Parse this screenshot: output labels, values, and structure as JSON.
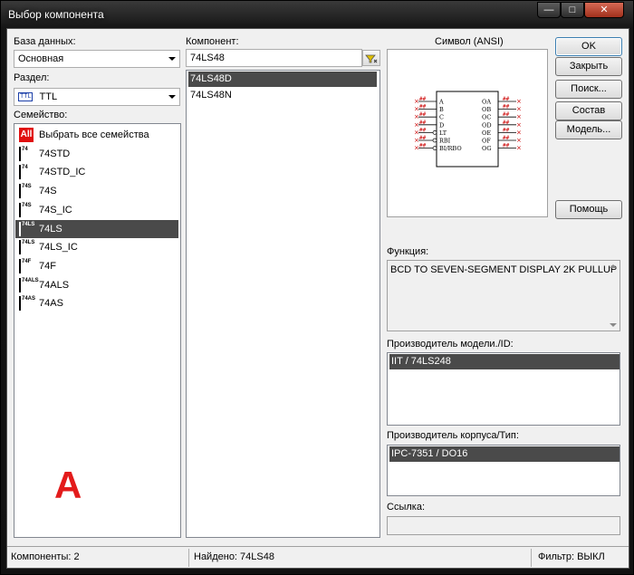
{
  "window": {
    "title": "Выбор компонента"
  },
  "database": {
    "label": "База данных:",
    "value": "Основная"
  },
  "section": {
    "label": "Раздел:",
    "value": "TTL",
    "icon_text": "TTL"
  },
  "family": {
    "label": "Семейство:",
    "items": [
      {
        "label": "Выбрать все семейства",
        "icon": "All"
      },
      {
        "label": "74STD",
        "icon": "74"
      },
      {
        "label": "74STD_IC",
        "icon": "74"
      },
      {
        "label": "74S",
        "icon": "74S"
      },
      {
        "label": "74S_IC",
        "icon": "74S"
      },
      {
        "label": "74LS",
        "icon": "74LS"
      },
      {
        "label": "74LS_IC",
        "icon": "74LS"
      },
      {
        "label": "74F",
        "icon": "74F"
      },
      {
        "label": "74ALS",
        "icon": "74ALS"
      },
      {
        "label": "74AS",
        "icon": "74AS"
      }
    ],
    "selected_index": 5
  },
  "component": {
    "label": "Компонент:",
    "value": "74LS48",
    "items": [
      "74LS48D",
      "74LS48N"
    ],
    "selected_index": 0
  },
  "symbol": {
    "label": "Символ (ANSI)",
    "pins_left": [
      "A",
      "B",
      "C",
      "D",
      "LT",
      "RBI",
      "BI/RBO"
    ],
    "pins_right": [
      "OA",
      "OB",
      "OC",
      "OD",
      "OE",
      "OF",
      "OG"
    ],
    "pin_tag": "##"
  },
  "buttons": {
    "ok": "OK",
    "close": "Закрыть",
    "search": "Поиск...",
    "composition": "Состав",
    "model": "Модель...",
    "help": "Помощь"
  },
  "function": {
    "label": "Функция:",
    "value": "BCD TO SEVEN-SEGMENT DISPLAY 2K PULLUP"
  },
  "model_maker": {
    "label": "Производитель модели./ID:",
    "value": "IIT / 74LS248"
  },
  "package_maker": {
    "label": "Производитель корпуса/Тип:",
    "value": "IPC-7351 / DO16"
  },
  "link": {
    "label": "Ссылка:",
    "value": ""
  },
  "annotation": {
    "letter": "A"
  },
  "status": {
    "components": "Компоненты: 2",
    "found": "Найдено: 74LS48",
    "filter": "Фильтр: ВЫКЛ"
  }
}
